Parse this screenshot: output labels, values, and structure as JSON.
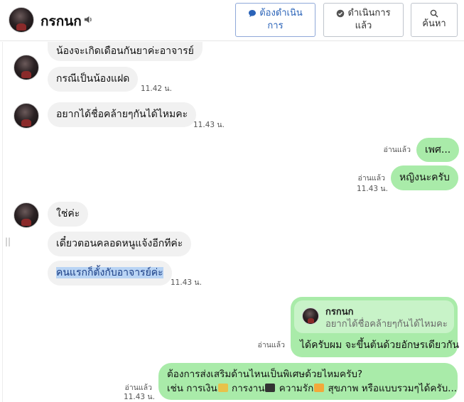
{
  "header": {
    "contact_name": "กรกนก",
    "buttons": {
      "todo_label": "ต้องดำเนิน",
      "todo_label_2": "การ",
      "done_label": "ดำเนินการ",
      "done_label_2": "แล้ว",
      "search_label": "ค้นหา"
    }
  },
  "messages": {
    "m1_text": "น้องจะเกิดเดือนกันยาค่ะอาจารย์",
    "m2_text": "กรณีเป็นน้องแฝด",
    "m2_time": "11.42 น.",
    "m3_text": "อยากได้ชื่อคล้ายๆกันได้ไหมคะ",
    "m3_time": "11.43 น.",
    "m4_read": "อ่านแล้ว",
    "m4_text": "เพศ...",
    "m5_read": "อ่านแล้ว",
    "m5_time": "11.43 น.",
    "m5_text": "หญิงนะครับ",
    "m6_text": "ใช่ค่ะ",
    "m7_text": "เดี๋ยวตอนคลอดหนูแจ้งอีกทีค่ะ",
    "m8_text": "คนแรกก็ตั้งกับอาจารย์ค่ะ",
    "m8_time": "11.43 น.",
    "reply_name": "กรกนก",
    "reply_quote": "อยากได้ชื่อคล้ายๆกันได้ไหมคะ",
    "reply_text": "ได้ครับผม จะขึ้นต้นด้วยอักษรเดียวกัน",
    "reply_read": "อ่านแล้ว",
    "long_read": "อ่านแล้ว",
    "long_time": "11.43 น.",
    "long_line1": "ต้องการส่งเสริมด้านไหนเป็นพิเศษด้วยไหมครับ?",
    "long_line2_a": "เช่น การเงิน",
    "long_line2_b": " การงาน",
    "long_line2_c": " ความรัก",
    "long_line2_d": " สุขภาพ หรือแบบรวมๆได้ครับ..."
  },
  "colors": {
    "incoming_bubble": "#f1f1f1",
    "outgoing_bubble": "#a9eba9",
    "primary_blue": "#2a63b8",
    "highlight": "#b9d4f4"
  },
  "icons": [
    "speaker-icon",
    "chat-bubble-icon",
    "check-circle-icon",
    "search-icon"
  ]
}
